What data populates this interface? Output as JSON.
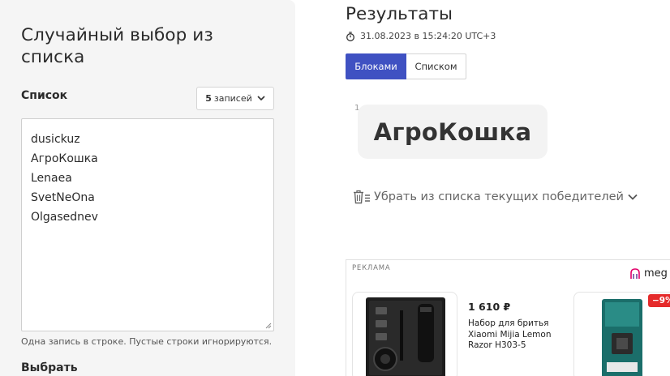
{
  "left_panel": {
    "title": "Случайный выбор из списка",
    "list_label": "Список",
    "entries_count": "5",
    "entries_suffix": "записей",
    "entries": [
      "dusickuz",
      "АгроКошка",
      "Lenaea",
      "SvetNeOna",
      "Olgasednev"
    ],
    "hint": "Одна запись в строке. Пустые строки игнорируются.",
    "choose_label": "Выбрать"
  },
  "results": {
    "title": "Результаты",
    "timestamp": "31.08.2023 в 15:24:20 UTC+3",
    "view_blocks": "Блоками",
    "view_list": "Списком",
    "winner_index": "1",
    "winner_name": "АгроКошка",
    "remove_winners": "Убрать из списка текущих победителей"
  },
  "ad": {
    "label": "РЕКЛАМА",
    "brand": "meg",
    "product_price": "1 610 ₽",
    "product_name": "Набор для бритья Xiaomi Mijia Lemon Razor H303-5",
    "discount": "−9%"
  },
  "colors": {
    "accent": "#3f51c2",
    "panel_bg": "#f5f5f5",
    "discount": "#e52b2b"
  }
}
